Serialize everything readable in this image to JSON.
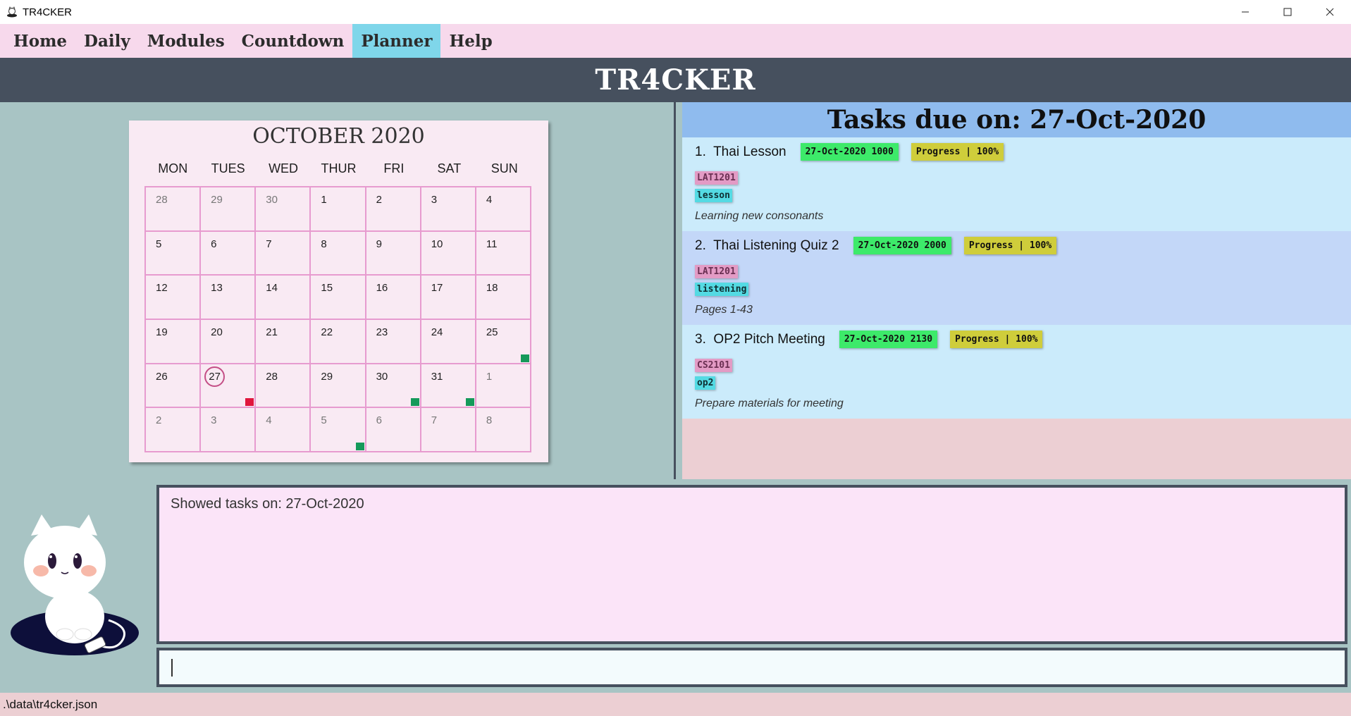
{
  "window": {
    "title": "TR4CKER",
    "controls": [
      "minimize",
      "maximize",
      "close"
    ]
  },
  "menu": {
    "items": [
      "Home",
      "Daily",
      "Modules",
      "Countdown",
      "Planner",
      "Help"
    ],
    "active": "Planner"
  },
  "banner": {
    "title": "TR4CKER"
  },
  "calendar": {
    "title": "OCTOBER 2020",
    "days": [
      "MON",
      "TUES",
      "WED",
      "THUR",
      "FRI",
      "SAT",
      "SUN"
    ],
    "cells": [
      {
        "n": "28",
        "other": true
      },
      {
        "n": "29",
        "other": true
      },
      {
        "n": "30",
        "other": true
      },
      {
        "n": "1"
      },
      {
        "n": "2"
      },
      {
        "n": "3"
      },
      {
        "n": "4"
      },
      {
        "n": "5"
      },
      {
        "n": "6"
      },
      {
        "n": "7"
      },
      {
        "n": "8"
      },
      {
        "n": "9"
      },
      {
        "n": "10"
      },
      {
        "n": "11"
      },
      {
        "n": "12"
      },
      {
        "n": "13"
      },
      {
        "n": "14"
      },
      {
        "n": "15"
      },
      {
        "n": "16"
      },
      {
        "n": "17"
      },
      {
        "n": "18"
      },
      {
        "n": "19"
      },
      {
        "n": "20"
      },
      {
        "n": "21"
      },
      {
        "n": "22"
      },
      {
        "n": "23"
      },
      {
        "n": "24"
      },
      {
        "n": "25",
        "marker": "green"
      },
      {
        "n": "26"
      },
      {
        "n": "27",
        "today": true,
        "marker": "red"
      },
      {
        "n": "28"
      },
      {
        "n": "29"
      },
      {
        "n": "30",
        "marker": "green"
      },
      {
        "n": "31",
        "marker": "green"
      },
      {
        "n": "1",
        "other": true
      },
      {
        "n": "2",
        "other": true
      },
      {
        "n": "3",
        "other": true
      },
      {
        "n": "4",
        "other": true
      },
      {
        "n": "5",
        "other": true,
        "marker": "green"
      },
      {
        "n": "6",
        "other": true
      },
      {
        "n": "7",
        "other": true
      },
      {
        "n": "8",
        "other": true
      }
    ],
    "colors": {
      "grid": "#e79bcf",
      "marker_green": "#159a5a",
      "marker_red": "#e0163c",
      "today_ring": "#c44f86"
    }
  },
  "tasks_panel": {
    "header": "Tasks due on: 27-Oct-2020",
    "tasks": [
      {
        "index": "1.",
        "title": "Thai Lesson",
        "datetime": "27-Oct-2020 1000",
        "progress": "Progress | 100%",
        "module": "LAT1201",
        "type": "lesson",
        "description": "Learning new consonants",
        "bg": "#cbebfb"
      },
      {
        "index": "2.",
        "title": "Thai Listening Quiz 2",
        "datetime": "27-Oct-2020 2000",
        "progress": "Progress | 100%",
        "module": "LAT1201",
        "type": "listening",
        "description": "Pages 1-43",
        "bg": "#c3d7f8"
      },
      {
        "index": "3.",
        "title": "OP2 Pitch Meeting",
        "datetime": "27-Oct-2020 2130",
        "progress": "Progress | 100%",
        "module": "CS2101",
        "type": "op2",
        "description": "Prepare materials for meeting",
        "bg": "#cbebfb"
      }
    ]
  },
  "result": {
    "text": "Showed tasks on: 27-Oct-2020"
  },
  "command": {
    "value": ""
  },
  "status": {
    "path": ".\\data\\tr4cker.json"
  }
}
